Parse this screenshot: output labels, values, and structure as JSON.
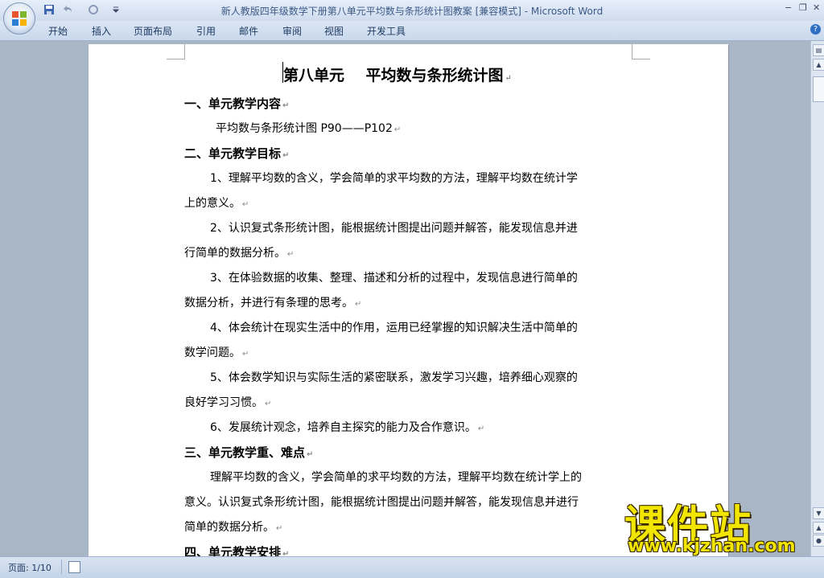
{
  "window": {
    "title": "新人教版四年级数学下册第八单元平均数与条形统计图教案 [兼容模式] - Microsoft Word",
    "minimize": "−",
    "restore": "❐",
    "close": "✕"
  },
  "quick_access": {
    "save_icon": "save-icon",
    "undo_icon": "undo-icon",
    "redo_icon": "redo-icon"
  },
  "ribbon": {
    "tabs": [
      "开始",
      "插入",
      "页面布局",
      "引用",
      "邮件",
      "审阅",
      "视图",
      "开发工具"
    ],
    "help": "?"
  },
  "document": {
    "title": "第八单元    平均数与条形统计图",
    "paragraph_mark": "↵",
    "lines": [
      "一、单元教学内容",
      "平均数与条形统计图 P90——P102",
      "二、单元教学目标",
      "1、理解平均数的含义，学会简单的求平均数的方法，理解平均数在统计学",
      "上的意义。",
      "2、认识复式条形统计图，能根据统计图提出问题并解答，能发现信息并进",
      "行简单的数据分析。",
      "3、在体验数据的收集、整理、描述和分析的过程中，发现信息进行简单的",
      "数据分析，并进行有条理的思考。",
      "4、体会统计在现实生活中的作用，运用已经掌握的知识解决生活中简单的",
      "数学问题。",
      "5、体会数学知识与实际生活的紧密联系，激发学习兴趣，培养细心观察的",
      "良好学习习惯。",
      "6、发展统计观念，培养自主探究的能力及合作意识。",
      "三、单元教学重、难点",
      "理解平均数的含义，学会简单的求平均数的方法，理解平均数在统计学上的",
      "意义。认识复式条形统计图，能根据统计图提出问题并解答，能发现信息并进行",
      "简单的数据分析。",
      "四、单元教学安排"
    ]
  },
  "status_bar": {
    "page": "页面: 1/10"
  },
  "watermark": {
    "main": "课件站",
    "sub": "www.kjzhan.com"
  }
}
